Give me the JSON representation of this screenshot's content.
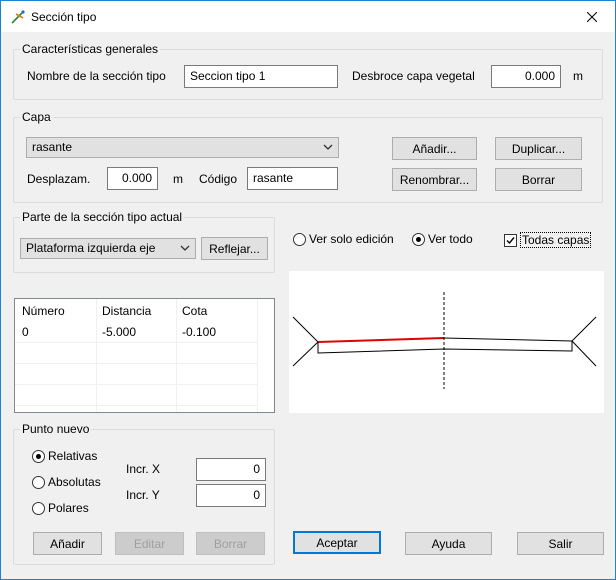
{
  "window": {
    "title": "Sección tipo"
  },
  "general": {
    "legend": "Características generales",
    "name_label": "Nombre de la sección tipo",
    "name_value": "Seccion tipo 1",
    "clearing_label": "Desbroce capa vegetal",
    "clearing_value": "0.000",
    "clearing_unit": "m"
  },
  "layer": {
    "legend": "Capa",
    "selected": "rasante",
    "offset_label": "Desplazam.",
    "offset_value": "0.000",
    "offset_unit": "m",
    "code_label": "Código",
    "code_value": "rasante",
    "add_label": "Añadir...",
    "duplicate_label": "Duplicar...",
    "rename_label": "Renombrar...",
    "delete_label": "Borrar"
  },
  "part": {
    "legend": "Parte de la sección tipo actual",
    "selected": "Plataforma izquierda eje",
    "reflect_label": "Reflejar..."
  },
  "view": {
    "edit_only_label": "Ver solo edición",
    "view_all_label": "Ver todo",
    "all_layers_label": "Todas capas",
    "selected": "view_all",
    "all_layers_checked": true
  },
  "points_table": {
    "columns": [
      "Número",
      "Distancia",
      "Cota"
    ],
    "rows": [
      [
        "0",
        "-5.000",
        "-0.100"
      ]
    ]
  },
  "new_point": {
    "legend": "Punto nuevo",
    "relative_label": "Relativas",
    "absolute_label": "Absolutas",
    "polar_label": "Polares",
    "mode": "relative",
    "incr_x_label": "Incr. X",
    "incr_x_value": "0",
    "incr_y_label": "Incr. Y",
    "incr_y_value": "0",
    "add_label": "Añadir",
    "edit_label": "Editar",
    "delete_label": "Borrar"
  },
  "footer": {
    "accept_label": "Aceptar",
    "help_label": "Ayuda",
    "exit_label": "Salir"
  },
  "colors": {
    "highlight_segment": "#e00000",
    "accent": "#0078d7"
  }
}
